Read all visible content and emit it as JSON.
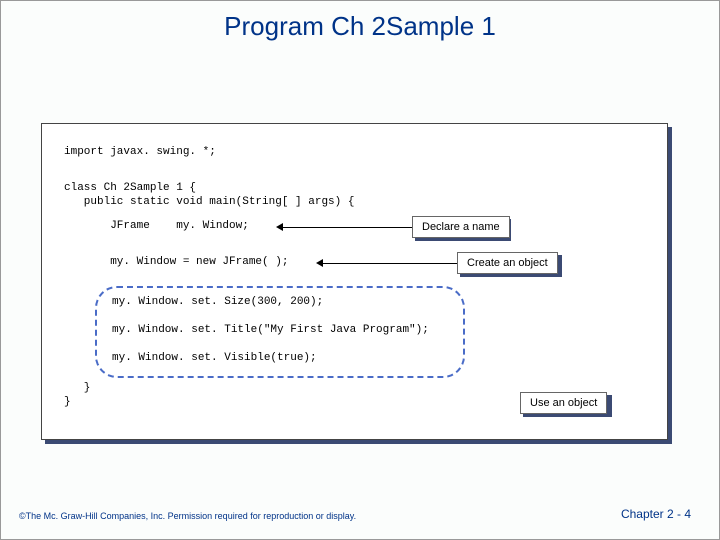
{
  "title": "Program Ch 2Sample 1",
  "code": {
    "import_line": "import javax. swing. *;",
    "class_open": "class Ch 2Sample 1 {",
    "main_sig": "   public static void main(String[ ] args) {",
    "declare": "       JFrame    my. Window;",
    "create": "       my. Window = new JFrame( );",
    "set_size": "my. Window. set. Size(300, 200);",
    "set_title": "my. Window. set. Title(\"My First Java Program\");",
    "set_visible": "my. Window. set. Visible(true);",
    "brace_inner": "   }",
    "brace_outer": "}"
  },
  "callouts": {
    "declare": "Declare a name",
    "create": "Create an object",
    "use": "Use an object"
  },
  "footer": {
    "copyright": "©The Mc. Graw-Hill Companies, Inc. Permission required for reproduction or display.",
    "page": "Chapter 2 - 4"
  }
}
